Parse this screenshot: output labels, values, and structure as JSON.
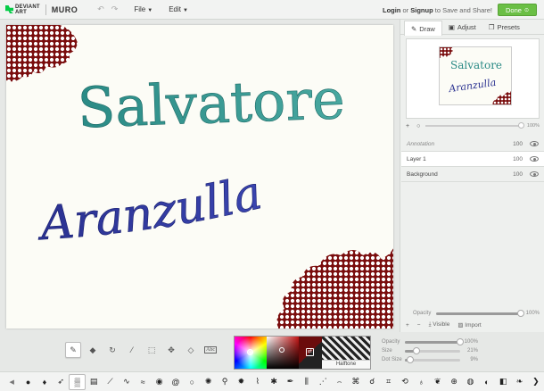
{
  "header": {
    "logo_line1": "DEVIANT",
    "logo_line2": "ART",
    "app_name": "MURO",
    "menu_file": "File",
    "menu_edit": "Edit",
    "login": "Login",
    "or": "or",
    "signup": "Signup",
    "save_share": "to Save and Share!",
    "done": "Done"
  },
  "canvas": {
    "line1": "Salvatore",
    "line2": "Aranzulla",
    "line1_color": "#2a8a85",
    "line2_color": "#2a3190",
    "blob_color": "#7a0d0d"
  },
  "panel": {
    "tabs": [
      {
        "label": "Draw",
        "icon": "brush-icon"
      },
      {
        "label": "Adjust",
        "icon": "adjust-icon"
      },
      {
        "label": "Presets",
        "icon": "presets-icon"
      }
    ],
    "zoom_percent": "100%",
    "layers": [
      {
        "name": "Annotation",
        "opacity": "100"
      },
      {
        "name": "Layer 1",
        "opacity": "100"
      },
      {
        "name": "Background",
        "opacity": "100"
      }
    ],
    "opacity_label": "Opacity",
    "opacity_value": "100%",
    "visible_label": "Visible",
    "import_label": "Import"
  },
  "tools": {
    "text_tool": "Abc",
    "brush_name": "Halftone",
    "sliders": [
      {
        "label": "Opacity",
        "value": "100%",
        "level": 1.0
      },
      {
        "label": "Size",
        "value": "21%",
        "level": 0.21
      },
      {
        "label": "Dot Size",
        "value": "9%",
        "level": 0.09
      }
    ]
  },
  "brushes": [
    "dot-brush",
    "drop-brush",
    "feather-brush",
    "halftone-brush",
    "hatch-brush",
    "line-brush",
    "scribble-brush",
    "wave-brush",
    "fill-brush",
    "spiral-brush",
    "ring-brush",
    "sponge-brush",
    "dropper-brush",
    "splat-brush",
    "grass-brush",
    "star-brush",
    "pen-brush",
    "bristle-brush",
    "fan-brush",
    "comb-brush",
    "swirl-brush",
    "loop-brush",
    "lattice-brush",
    "chain-brush",
    "drip-brush",
    "leaf-brush",
    "cross-brush",
    "circle-brush",
    "half-brush",
    "eraser-brush",
    "curl-brush",
    "chevron-brush"
  ]
}
